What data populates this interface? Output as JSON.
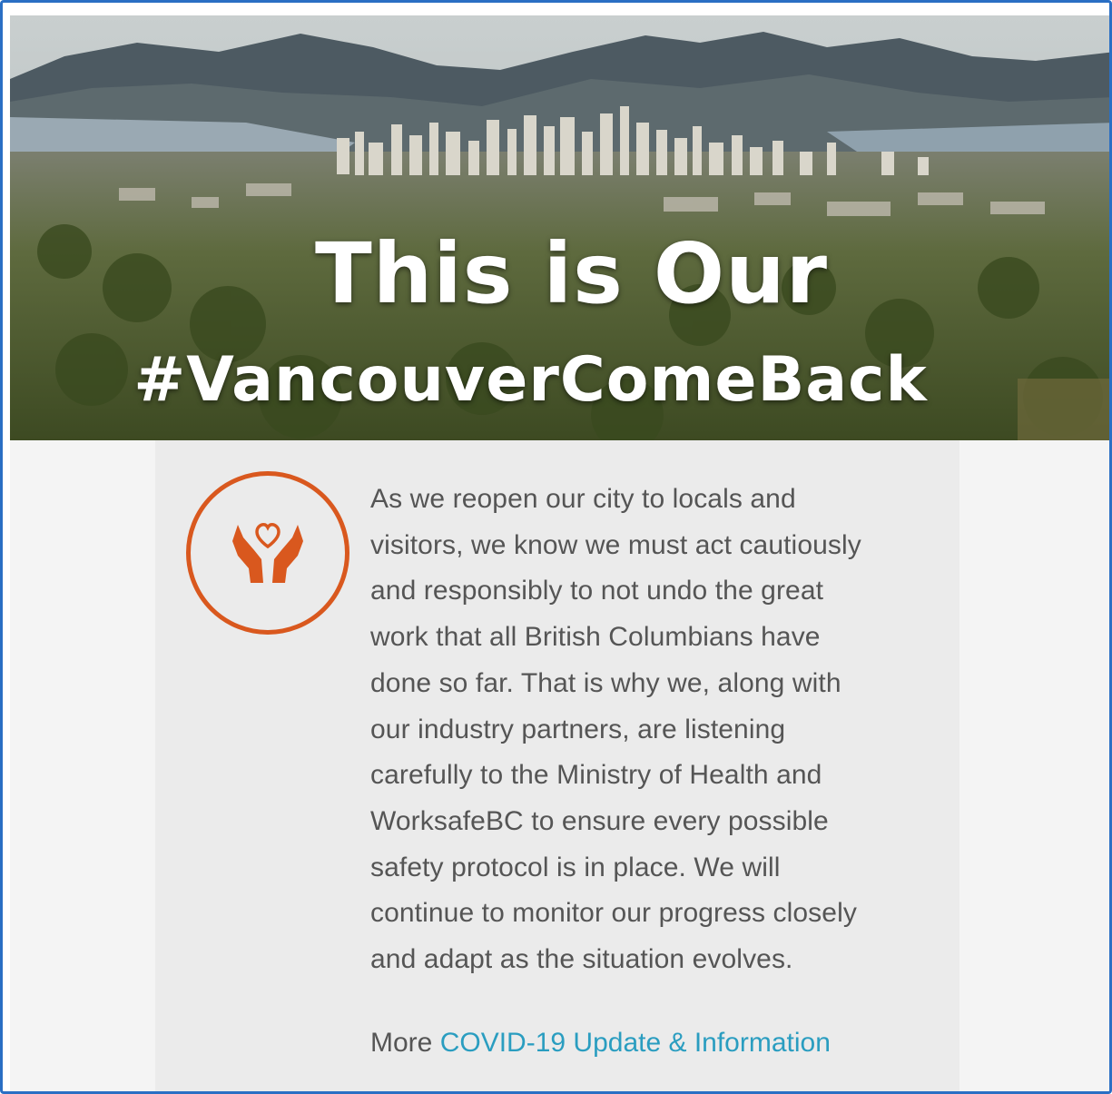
{
  "hero": {
    "title_line1": "This is Our",
    "title_line2": "#VancouverComeBack"
  },
  "content": {
    "icon": "hands-heart-icon",
    "accent_color": "#d9581e",
    "paragraph_lines": [
      "As we reopen our city to locals and",
      "visitors, we know we must act cautiously",
      "and responsibly to not undo the great",
      "work that all British Columbians have",
      "done so far. That is why we, along with",
      "our industry partners, are listening",
      "carefully to the Ministry of Health and",
      "WorksafeBC to ensure every possible",
      "safety protocol is in place. We will",
      "continue to monitor our progress closely",
      "and adapt as the situation evolves."
    ],
    "more_prefix": "More",
    "more_link": "COVID-19 Update & Information",
    "link_color": "#2a9dc0"
  }
}
